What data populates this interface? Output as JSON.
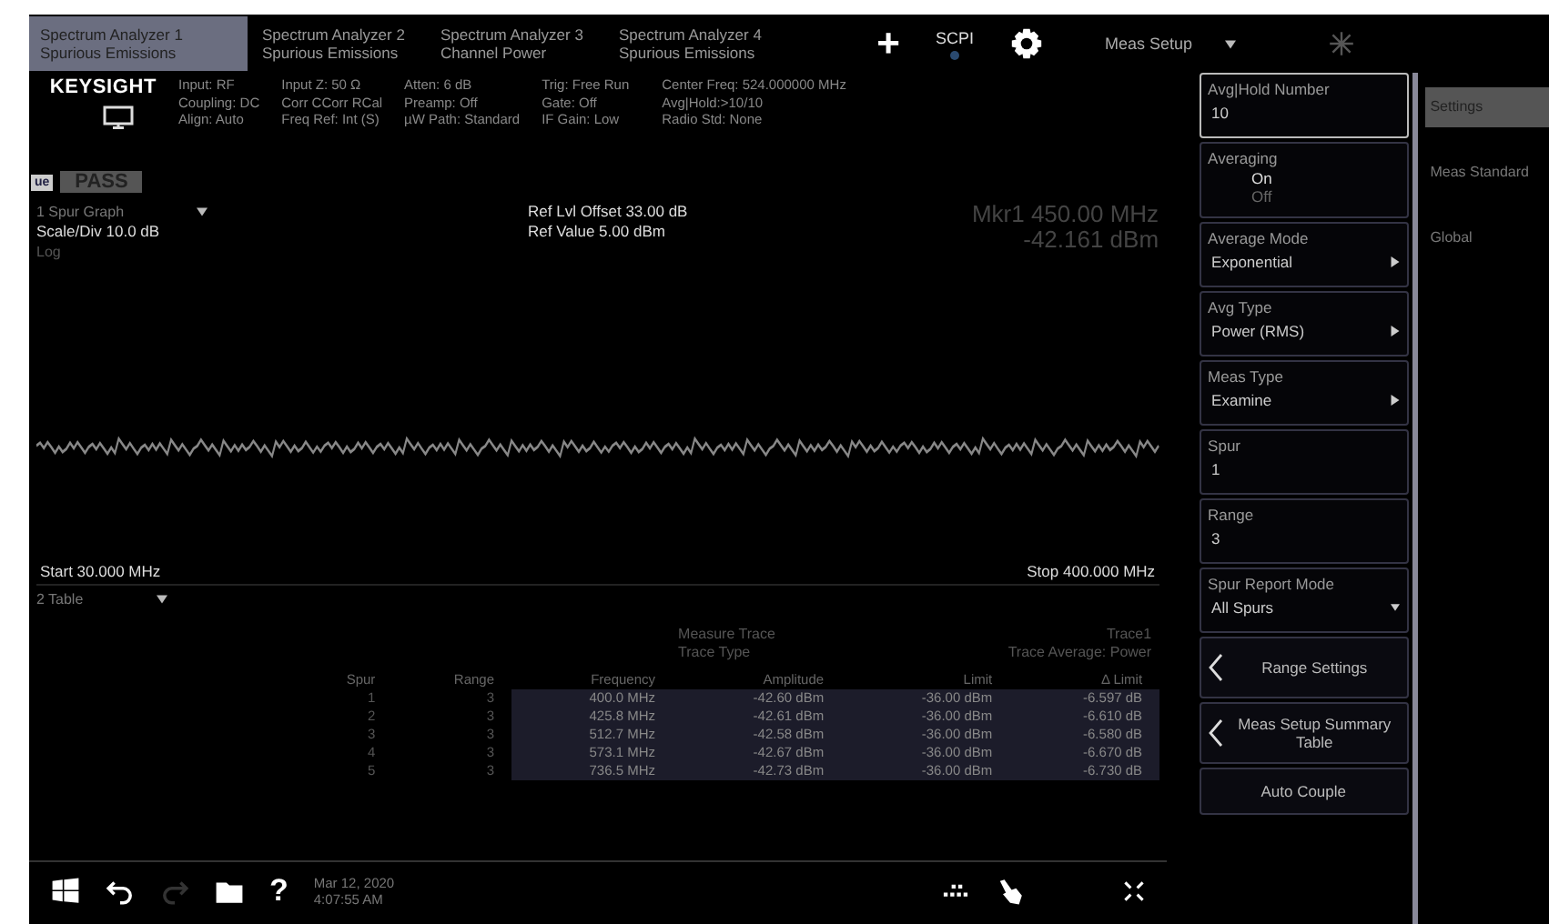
{
  "tabs": [
    {
      "line1": "Spectrum Analyzer 1",
      "line2": "Spurious Emissions",
      "selected": true
    },
    {
      "line1": "Spectrum Analyzer 2",
      "line2": "Spurious Emissions",
      "selected": false
    },
    {
      "line1": "Spectrum Analyzer 3",
      "line2": "Channel Power",
      "selected": false
    },
    {
      "line1": "Spectrum Analyzer 4",
      "line2": "Spurious Emissions",
      "selected": false
    }
  ],
  "toolbar": {
    "add": "+",
    "scpi": "SCPI",
    "menu": "Meas Setup"
  },
  "logo": "KEYSIGHT",
  "info": [
    [
      "Input: RF",
      "Coupling: DC",
      "Align: Auto"
    ],
    [
      "Input Z: 50 Ω",
      "Corr CCorr RCal",
      "Freq Ref: Int (S)"
    ],
    [
      "Atten: 6 dB",
      "Preamp: Off",
      "µW Path: Standard"
    ],
    [
      "Trig: Free Run",
      "Gate: Off",
      "IF Gain: Low"
    ],
    [
      "Center Freq: 524.000000 MHz",
      "Avg|Hold:>10/10",
      "Radio Std: None"
    ]
  ],
  "badge": "ue",
  "status": "PASS",
  "graph": {
    "title": "1 Spur Graph",
    "ref_offset": "Ref Lvl Offset 33.00 dB",
    "ref_value": "Ref Value 5.00 dBm",
    "marker_freq": "Mkr1 450.00 MHz",
    "marker_amp": "-42.161 dBm",
    "scale": "Scale/Div 10.0 dB",
    "log": "Log",
    "start": "Start 30.000 MHz",
    "stop": "Stop 400.000 MHz"
  },
  "table_window": {
    "title": "2 Table",
    "meta": [
      {
        "label": "Measure Trace",
        "value": "Trace1"
      },
      {
        "label": "Trace Type",
        "value": "Trace Average: Power"
      }
    ],
    "columns": [
      "Spur",
      "Range",
      "Frequency",
      "Amplitude",
      "Limit",
      "Δ Limit"
    ],
    "rows": [
      [
        "1",
        "3",
        "400.0 MHz",
        "-42.60 dBm",
        "-36.00 dBm",
        "-6.597 dB"
      ],
      [
        "2",
        "3",
        "425.8 MHz",
        "-42.61 dBm",
        "-36.00 dBm",
        "-6.610 dB"
      ],
      [
        "3",
        "3",
        "512.7 MHz",
        "-42.58 dBm",
        "-36.00 dBm",
        "-6.580 dB"
      ],
      [
        "4",
        "3",
        "573.1 MHz",
        "-42.67 dBm",
        "-36.00 dBm",
        "-6.670 dB"
      ],
      [
        "5",
        "3",
        "736.5 MHz",
        "-42.73 dBm",
        "-36.00 dBm",
        "-6.730 dB"
      ]
    ]
  },
  "taskbar": {
    "help": "?",
    "redo": {
      "disabled": true
    },
    "date": "Mar 12, 2020",
    "time": "4:07:55 AM"
  },
  "softkeys": [
    {
      "kind": "value",
      "label": "Avg|Hold Number",
      "value": "10"
    },
    {
      "kind": "radio",
      "label": "Averaging",
      "options": [
        {
          "label": "On",
          "selected": true
        },
        {
          "label": "Off",
          "selected": false
        }
      ]
    },
    {
      "kind": "menu",
      "label": "Average Mode",
      "value": "Exponential"
    },
    {
      "kind": "menu",
      "label": "Avg Type",
      "value": "Power (RMS)"
    },
    {
      "kind": "menu",
      "label": "Meas Type",
      "value": "Examine"
    },
    {
      "kind": "value",
      "label": "Spur",
      "value": "1"
    },
    {
      "kind": "value",
      "label": "Range",
      "value": "3"
    },
    {
      "kind": "dropdown",
      "label": "Spur Report Mode",
      "value": "All Spurs"
    },
    {
      "kind": "nav",
      "label": "Range Settings"
    },
    {
      "kind": "nav",
      "label": "Meas Setup Summary Table"
    },
    {
      "kind": "button",
      "label": "Auto Couple"
    }
  ],
  "side_tabs": [
    {
      "label": "Settings",
      "selected": true
    },
    {
      "label": "Meas Standard",
      "selected": false
    },
    {
      "label": "Global",
      "selected": false
    }
  ]
}
